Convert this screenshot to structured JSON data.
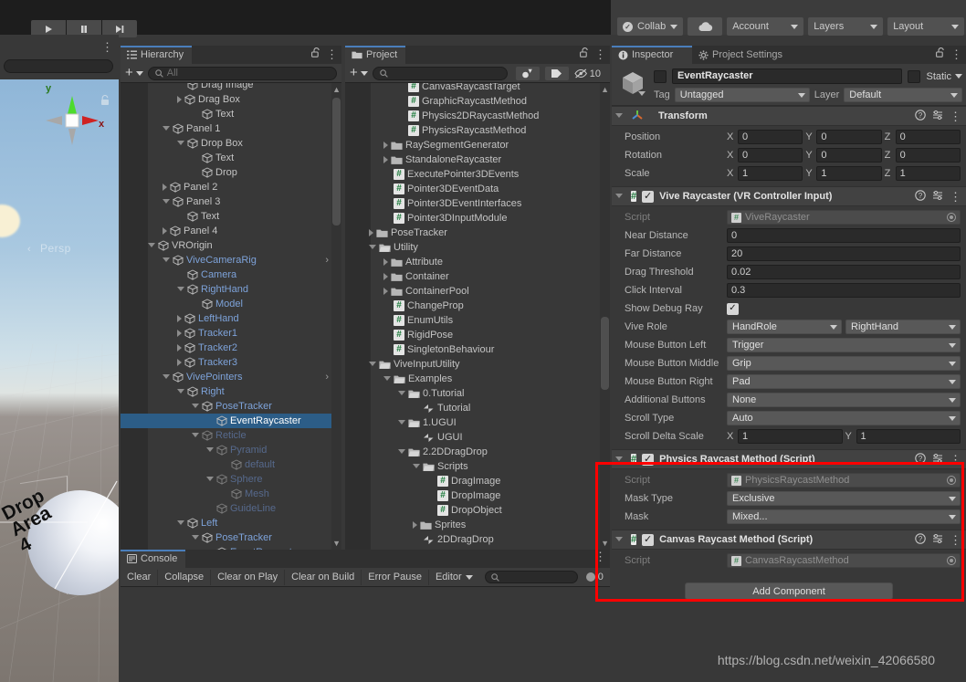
{
  "toolbar": {
    "play_icon": "play-icon",
    "pause_icon": "pause-icon",
    "step_icon": "step-icon",
    "collab_label": "Collab",
    "cloud_icon": "cloud-icon",
    "account_label": "Account",
    "layers_label": "Layers",
    "layout_label": "Layout"
  },
  "scene": {
    "axis_y": "y",
    "axis_x": "x",
    "persp_label": "Persp",
    "object_label": "Drop\nArea\n4",
    "lock_icon": "lock-icon"
  },
  "hierarchy": {
    "tab_label": "Hierarchy",
    "tab_icon": "hierarchy-icon",
    "lock_icon": "lock-open-icon",
    "menu_icon": "kebab-icon",
    "search_placeholder": "All",
    "search_value": "",
    "rows": [
      {
        "label": "Drag Image",
        "depth": 3,
        "arrow": "none",
        "style": "normal",
        "clipped": true
      },
      {
        "label": "Drag Box",
        "depth": 3,
        "arrow": "closed",
        "style": "normal"
      },
      {
        "label": "Text",
        "depth": 4,
        "arrow": "none",
        "style": "normal"
      },
      {
        "label": "Panel 1",
        "depth": 2,
        "arrow": "open",
        "style": "normal"
      },
      {
        "label": "Drop Box",
        "depth": 3,
        "arrow": "open",
        "style": "normal"
      },
      {
        "label": "Text",
        "depth": 4,
        "arrow": "none",
        "style": "normal"
      },
      {
        "label": "Drop",
        "depth": 4,
        "arrow": "none",
        "style": "normal"
      },
      {
        "label": "Panel 2",
        "depth": 2,
        "arrow": "closed",
        "style": "normal"
      },
      {
        "label": "Panel 3",
        "depth": 2,
        "arrow": "open",
        "style": "normal"
      },
      {
        "label": "Text",
        "depth": 3,
        "arrow": "none",
        "style": "normal"
      },
      {
        "label": "Panel 4",
        "depth": 2,
        "arrow": "closed",
        "style": "normal"
      },
      {
        "label": "VROrigin",
        "depth": 1,
        "arrow": "open",
        "style": "normal"
      },
      {
        "label": "ViveCameraRig",
        "depth": 2,
        "arrow": "open",
        "style": "prefab",
        "more": true
      },
      {
        "label": "Camera",
        "depth": 3,
        "arrow": "none",
        "style": "prefab"
      },
      {
        "label": "RightHand",
        "depth": 3,
        "arrow": "open",
        "style": "prefab"
      },
      {
        "label": "Model",
        "depth": 4,
        "arrow": "none",
        "style": "prefab"
      },
      {
        "label": "LeftHand",
        "depth": 3,
        "arrow": "closed",
        "style": "prefab"
      },
      {
        "label": "Tracker1",
        "depth": 3,
        "arrow": "closed",
        "style": "prefab"
      },
      {
        "label": "Tracker2",
        "depth": 3,
        "arrow": "closed",
        "style": "prefab"
      },
      {
        "label": "Tracker3",
        "depth": 3,
        "arrow": "closed",
        "style": "prefab"
      },
      {
        "label": "VivePointers",
        "depth": 2,
        "arrow": "open",
        "style": "prefab",
        "more": true
      },
      {
        "label": "Right",
        "depth": 3,
        "arrow": "open",
        "style": "prefab"
      },
      {
        "label": "PoseTracker",
        "depth": 4,
        "arrow": "open",
        "style": "prefab"
      },
      {
        "label": "EventRaycaster",
        "depth": 5,
        "arrow": "none",
        "style": "prefab",
        "selected": true
      },
      {
        "label": "Reticle",
        "depth": 4,
        "arrow": "open",
        "style": "prefab-inactive"
      },
      {
        "label": "Pyramid",
        "depth": 5,
        "arrow": "open",
        "style": "prefab-inactive"
      },
      {
        "label": "default",
        "depth": 6,
        "arrow": "none",
        "style": "prefab-inactive"
      },
      {
        "label": "Sphere",
        "depth": 5,
        "arrow": "open",
        "style": "prefab-inactive"
      },
      {
        "label": "Mesh",
        "depth": 6,
        "arrow": "none",
        "style": "prefab-inactive"
      },
      {
        "label": "GuideLine",
        "depth": 5,
        "arrow": "none",
        "style": "prefab-inactive"
      },
      {
        "label": "Left",
        "depth": 3,
        "arrow": "open",
        "style": "prefab"
      },
      {
        "label": "PoseTracker",
        "depth": 4,
        "arrow": "open",
        "style": "prefab"
      },
      {
        "label": "EventRaycaster",
        "depth": 5,
        "arrow": "none",
        "style": "prefab",
        "clipped": true
      }
    ]
  },
  "project": {
    "tab_label": "Project",
    "tab_icon": "folder-icon",
    "lock_icon": "lock-open-icon",
    "menu_icon": "kebab-icon",
    "search_placeholder": "",
    "search_value": "",
    "filter_type_icon": "object-filter-icon",
    "filter_label_icon": "label-filter-icon",
    "hidden_icon": "eye-off-icon",
    "hidden_count": "10",
    "rows": [
      {
        "label": "CanvasRaycastTarget",
        "depth": 3,
        "arrow": "none",
        "icon": "script"
      },
      {
        "label": "GraphicRaycastMethod",
        "depth": 3,
        "arrow": "none",
        "icon": "script"
      },
      {
        "label": "Physics2DRaycastMethod",
        "depth": 3,
        "arrow": "none",
        "icon": "script"
      },
      {
        "label": "PhysicsRaycastMethod",
        "depth": 3,
        "arrow": "none",
        "icon": "script"
      },
      {
        "label": "RaySegmentGenerator",
        "depth": 2,
        "arrow": "closed",
        "icon": "folder"
      },
      {
        "label": "StandaloneRaycaster",
        "depth": 2,
        "arrow": "closed",
        "icon": "folder"
      },
      {
        "label": "ExecutePointer3DEvents",
        "depth": 2,
        "arrow": "none",
        "icon": "script"
      },
      {
        "label": "Pointer3DEventData",
        "depth": 2,
        "arrow": "none",
        "icon": "script"
      },
      {
        "label": "Pointer3DEventInterfaces",
        "depth": 2,
        "arrow": "none",
        "icon": "script"
      },
      {
        "label": "Pointer3DInputModule",
        "depth": 2,
        "arrow": "none",
        "icon": "script"
      },
      {
        "label": "PoseTracker",
        "depth": 1,
        "arrow": "closed",
        "icon": "folder"
      },
      {
        "label": "Utility",
        "depth": 1,
        "arrow": "open",
        "icon": "folder-open"
      },
      {
        "label": "Attribute",
        "depth": 2,
        "arrow": "closed",
        "icon": "folder"
      },
      {
        "label": "Container",
        "depth": 2,
        "arrow": "closed",
        "icon": "folder"
      },
      {
        "label": "ContainerPool",
        "depth": 2,
        "arrow": "closed",
        "icon": "folder"
      },
      {
        "label": "ChangeProp",
        "depth": 2,
        "arrow": "none",
        "icon": "script"
      },
      {
        "label": "EnumUtils",
        "depth": 2,
        "arrow": "none",
        "icon": "script"
      },
      {
        "label": "RigidPose",
        "depth": 2,
        "arrow": "none",
        "icon": "script"
      },
      {
        "label": "SingletonBehaviour",
        "depth": 2,
        "arrow": "none",
        "icon": "script"
      },
      {
        "label": "ViveInputUtility",
        "depth": 1,
        "arrow": "open",
        "icon": "folder-open"
      },
      {
        "label": "Examples",
        "depth": 2,
        "arrow": "open",
        "icon": "folder-open"
      },
      {
        "label": "0.Tutorial",
        "depth": 3,
        "arrow": "open",
        "icon": "folder-open"
      },
      {
        "label": "Tutorial",
        "depth": 4,
        "arrow": "none",
        "icon": "scene"
      },
      {
        "label": "1.UGUI",
        "depth": 3,
        "arrow": "open",
        "icon": "folder-open"
      },
      {
        "label": "UGUI",
        "depth": 4,
        "arrow": "none",
        "icon": "scene"
      },
      {
        "label": "2.2DDragDrop",
        "depth": 3,
        "arrow": "open",
        "icon": "folder-open"
      },
      {
        "label": "Scripts",
        "depth": 4,
        "arrow": "open",
        "icon": "folder-open"
      },
      {
        "label": "DragImage",
        "depth": 5,
        "arrow": "none",
        "icon": "script"
      },
      {
        "label": "DropImage",
        "depth": 5,
        "arrow": "none",
        "icon": "script"
      },
      {
        "label": "DropObject",
        "depth": 5,
        "arrow": "none",
        "icon": "script"
      },
      {
        "label": "Sprites",
        "depth": 4,
        "arrow": "closed",
        "icon": "folder"
      },
      {
        "label": "2DDragDrop",
        "depth": 4,
        "arrow": "none",
        "icon": "scene"
      }
    ]
  },
  "console": {
    "tab_label": "Console",
    "tab_icon": "console-icon",
    "menu_icon": "kebab-icon",
    "buttons": [
      "Clear",
      "Collapse",
      "Clear on Play",
      "Clear on Build",
      "Error Pause"
    ],
    "editor_label": "Editor",
    "search_placeholder": "",
    "search_value": "",
    "message_icon": "message-icon",
    "message_count": "0"
  },
  "inspector": {
    "tabs": [
      {
        "label": "Inspector",
        "icon": "info-icon",
        "active": true
      },
      {
        "label": "Project Settings",
        "icon": "gear-icon",
        "active": false
      }
    ],
    "lock_icon": "lock-open-icon",
    "menu_icon": "kebab-icon",
    "gameobject_icon": "gameobject-cube-icon",
    "enabled": false,
    "name": "EventRaycaster",
    "static_label": "Static",
    "static_checked": false,
    "tag_label": "Tag",
    "tag_value": "Untagged",
    "layer_label": "Layer",
    "layer_value": "Default",
    "components": [
      {
        "title": "Transform",
        "icon": "transform-axis-icon",
        "has_checkbox": false,
        "help_icon": "help-icon",
        "preset_icon": "preset-icon",
        "menu_icon": "kebab-icon",
        "vector_props": [
          {
            "name": "Position",
            "x": "0",
            "y": "0",
            "z": "0"
          },
          {
            "name": "Rotation",
            "x": "0",
            "y": "0",
            "z": "0"
          },
          {
            "name": "Scale",
            "x": "1",
            "y": "1",
            "z": "1"
          }
        ]
      },
      {
        "title": "Vive Raycaster (VR Controller Input)",
        "icon": "script-hash-icon",
        "has_checkbox": true,
        "checked": true,
        "help_icon": "help-icon",
        "preset_icon": "preset-icon",
        "menu_icon": "kebab-icon",
        "props": [
          {
            "name": "Script",
            "type": "object",
            "value": "ViveRaycaster",
            "dim": true
          },
          {
            "name": "Near Distance",
            "type": "input",
            "value": "0"
          },
          {
            "name": "Far Distance",
            "type": "input",
            "value": "20"
          },
          {
            "name": "Drag Threshold",
            "type": "input",
            "value": "0.02"
          },
          {
            "name": "Click Interval",
            "type": "input",
            "value": "0.3"
          },
          {
            "name": "Show Debug Ray",
            "type": "checkbox",
            "value": true
          },
          {
            "name": "Vive Role",
            "type": "dropdown2",
            "value": "HandRole",
            "value2": "RightHand"
          },
          {
            "name": "Mouse Button Left",
            "type": "dropdown",
            "value": "Trigger"
          },
          {
            "name": "Mouse Button Middle",
            "type": "dropdown",
            "value": "Grip"
          },
          {
            "name": "Mouse Button Right",
            "type": "dropdown",
            "value": "Pad"
          },
          {
            "name": "Additional Buttons",
            "type": "dropdown",
            "value": "None"
          },
          {
            "name": "Scroll Type",
            "type": "dropdown",
            "value": "Auto"
          },
          {
            "name": "Scroll Delta Scale",
            "type": "vector2",
            "x": "1",
            "y": "1"
          }
        ]
      },
      {
        "title": "Physics Raycast Method (Script)",
        "icon": "script-hash-icon",
        "has_checkbox": true,
        "checked": true,
        "help_icon": "help-icon",
        "preset_icon": "preset-icon",
        "menu_icon": "kebab-icon",
        "props": [
          {
            "name": "Script",
            "type": "object",
            "value": "PhysicsRaycastMethod",
            "dim": true
          },
          {
            "name": "Mask Type",
            "type": "dropdown",
            "value": "Exclusive"
          },
          {
            "name": "Mask",
            "type": "dropdown",
            "value": "Mixed..."
          }
        ]
      },
      {
        "title": "Canvas Raycast Method (Script)",
        "icon": "script-hash-icon",
        "has_checkbox": true,
        "checked": true,
        "help_icon": "help-icon",
        "preset_icon": "preset-icon",
        "menu_icon": "kebab-icon",
        "props": [
          {
            "name": "Script",
            "type": "object",
            "value": "CanvasRaycastMethod",
            "dim": true
          }
        ]
      }
    ],
    "add_component_label": "Add Component"
  },
  "annotation": {
    "highlight_color": "#ff0000"
  },
  "watermark": "https://blog.csdn.net/weixin_42066580"
}
